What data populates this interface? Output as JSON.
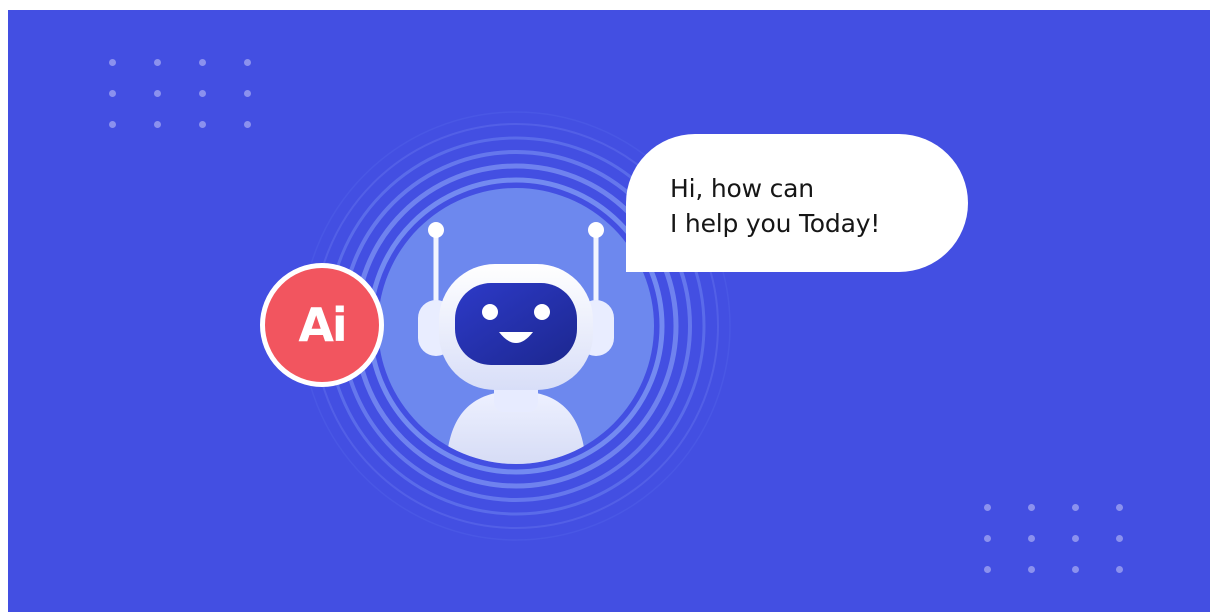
{
  "speech_bubble": {
    "line_1": "Hi, how can",
    "line_2": "I help you Today!"
  },
  "badge": {
    "label": "Ai"
  },
  "colors": {
    "background": "#434fe2",
    "badge": "#f2555f",
    "robot_face": "#2b35b8",
    "halo": "#6d88ee"
  },
  "icons": {
    "robot": "robot-icon",
    "badge": "ai-badge-icon"
  }
}
